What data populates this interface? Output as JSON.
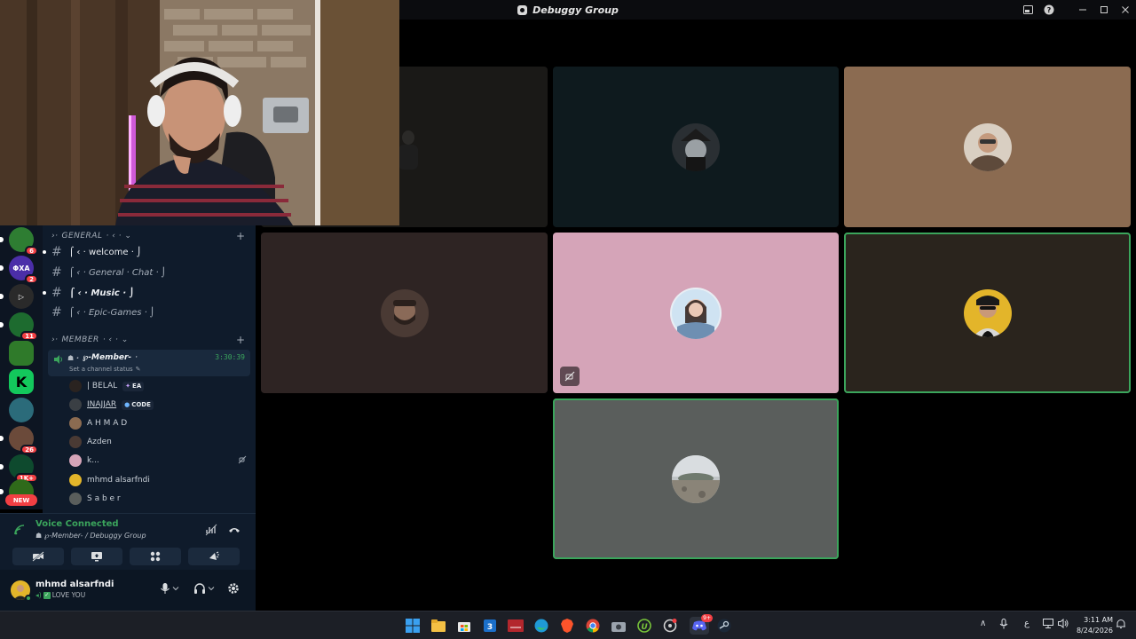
{
  "window": {
    "title": "Debuggy Group"
  },
  "channels": {
    "general_category": "GENERAL",
    "general_channels": [
      {
        "name": "welcome"
      },
      {
        "name": "General · Chat"
      },
      {
        "name": "Music"
      },
      {
        "name": "Epic-Games"
      }
    ],
    "member_category": "MEMBER",
    "voice_channel": {
      "name": "℘-Member-",
      "timer": "3:30:39",
      "status": "Set a channel status"
    },
    "voice_users": [
      {
        "name": "| BELAL",
        "tag": "EA"
      },
      {
        "name": "INAJJAR",
        "tag": "CODE"
      },
      {
        "name": "A H M A D",
        "tag": ""
      },
      {
        "name": "Azden",
        "tag": ""
      },
      {
        "name": "k...",
        "tag": ""
      },
      {
        "name": "mhmd alsarfndi",
        "tag": ""
      },
      {
        "name": "S a b e r",
        "tag": ""
      }
    ]
  },
  "servers": [
    {
      "label": "",
      "badge": "6",
      "color": "#2e7d32"
    },
    {
      "label": "ΦXA",
      "badge": "2",
      "color": "#4b2ea8"
    },
    {
      "label": "▷",
      "badge": "",
      "color": "#2a2a2a"
    },
    {
      "label": "",
      "badge": "11",
      "color": "#1d6b2f"
    },
    {
      "label": "",
      "badge": "",
      "color": "#2f7a2a"
    },
    {
      "label": "K",
      "badge": "",
      "color": "#13c85c"
    },
    {
      "label": "",
      "badge": "",
      "color": "#2b6b7a"
    },
    {
      "label": "",
      "badge": "26",
      "color": "#6b4a3a"
    },
    {
      "label": "",
      "badge": "1K+",
      "color": "#0e4a2e"
    },
    {
      "label": "",
      "badge": "",
      "color": "#2f6a1a"
    }
  ],
  "new_label": "NEW",
  "voice_panel": {
    "title": "Voice Connected",
    "subtitle": "℘-Member- / Debuggy Group"
  },
  "user_panel": {
    "name": "mhmd alsarfndi",
    "status": "LOVE YOU"
  },
  "taskbar": {
    "time": "3:11 AM",
    "date": "8/24/2026",
    "lang": "ع",
    "discord_badge": "9+"
  },
  "colors": {
    "accent_green": "#3ba55c",
    "sidebar_bg": "#0f1b2b"
  }
}
